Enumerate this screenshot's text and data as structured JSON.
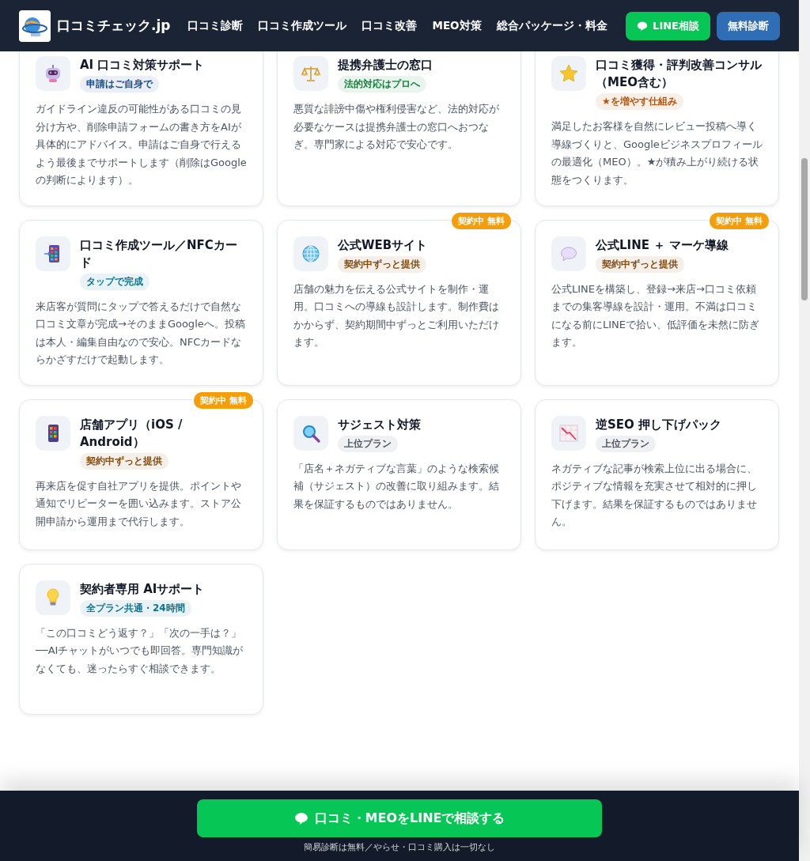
{
  "header": {
    "site_name": "口コミチェック.jp",
    "nav": [
      "口コミ診断",
      "口コミ作成ツール",
      "口コミ改善",
      "MEO対策",
      "総合パッケージ・料金"
    ],
    "buttons": [
      {
        "label": "LINE相談",
        "kind": "line"
      },
      {
        "label": "無料診断",
        "kind": "primary"
      }
    ]
  },
  "services": [
    {
      "title": "AI 口コミ対策サポート",
      "tag": {
        "label": "申請はご自身で",
        "color": "#1e4e8c"
      },
      "description": "ガイドライン違反の可能性がある口コミの見分け方や、削除申請フォームの書き方をAIが具体的にアドバイス。申請はご自身で行えるよう最後までサポートします（削除はGoogleの判断によります）。"
    },
    {
      "title": "提携弁護士の窓口",
      "tag": {
        "label": "法的対応はプロへ",
        "color": "#15803d"
      },
      "description": "悪質な誹謗中傷や権利侵害など、法的対応が必要なケースは提携弁護士の窓口へおつなぎ。専門家による対応で安心です。"
    },
    {
      "title": "口コミ獲得・評判改善コンサル（MEO含む）",
      "tag": {
        "label": "★を増やす仕組み",
        "color": "#b45309"
      },
      "description": "満足したお客様を自然にレビュー投稿へ導く導線づくりと、Googleビジネスプロフィールの最適化（MEO）。★が積み上がり続ける状態をつくります。"
    },
    {
      "title": "口コミ作成ツール／NFCカード",
      "tag": {
        "label": "タップで完成",
        "color": "#0e7490"
      },
      "description": "来店客が質問にタップで答えるだけで自然な口コミ文章が完成→そのままGoogleへ。投稿は本人・編集自由なので安心。NFCカードならかざすだけで起動します。"
    },
    {
      "title": "公式WEBサイト",
      "badge": "契約中 無料",
      "tag": {
        "label": "契約中ずっと提供",
        "color": "#854d0e"
      },
      "description": "店舗の魅力を伝える公式サイトを制作・運用。口コミへの導線も設計します。制作費はかからず、契約期間中ずっとご利用いただけます。"
    },
    {
      "title": "公式LINE ＋ マーケ導線",
      "badge": "契約中 無料",
      "tag": {
        "label": "契約中ずっと提供",
        "color": "#854d0e"
      },
      "description": "公式LINEを構築し、登録→来店→口コミ依頼までの集客導線を設計・運用。不満は口コミになる前にLINEで拾い、低評価を未然に防ぎます。"
    },
    {
      "title": "店舗アプリ（iOS / Android）",
      "badge": "契約中 無料",
      "tag": {
        "label": "契約中ずっと提供",
        "color": "#854d0e"
      },
      "description": "再来店を促す自社アプリを提供。ポイントや通知でリピーターを囲い込みます。ストア公開申請から運用まで代行します。"
    },
    {
      "title": "サジェスト対策",
      "tag": {
        "label": "上位プラン",
        "color": "#4b5563"
      },
      "description": "「店名＋ネガティブな言葉」のような検索候補（サジェスト）の改善に取り組みます。結果を保証するものではありません。"
    },
    {
      "title": "逆SEO 押し下げパック",
      "tag": {
        "label": "上位プラン",
        "color": "#4b5563"
      },
      "description": "ネガティブな記事が検索上位に出る場合に、ポジティブな情報を充実させて相対的に押し下げます。結果を保証するものではありません。"
    },
    {
      "title": "契約者専用 AIサポート",
      "tag": {
        "label": "全プラン共通・24時間",
        "color": "#0e7490"
      },
      "description": "「この口コミどう返す？」「次の一手は？」──AIチャットがいつでも即回答。専門知識がなくても、迷ったらすぐ相談できます。"
    }
  ],
  "footer_cta": {
    "button": "口コミ・MEOをLINEで相談する",
    "note": "簡易診断は無料／やらせ・口コミ購入は一切なし"
  }
}
